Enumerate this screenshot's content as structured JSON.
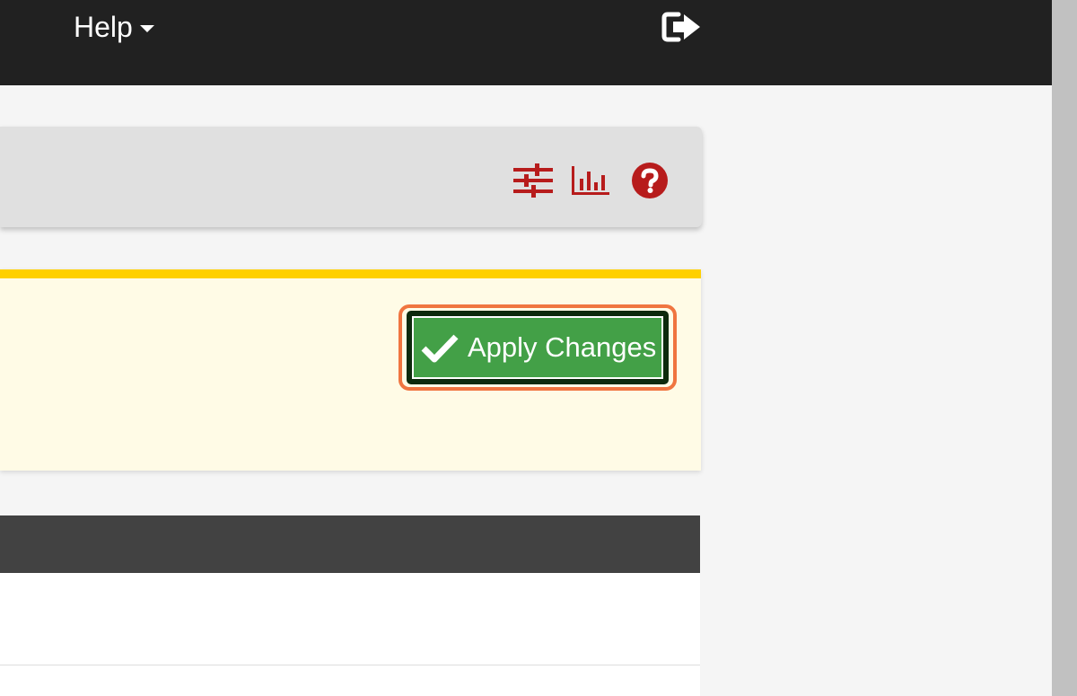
{
  "topnav": {
    "help_label": "Help",
    "logout_icon": "sign-out-icon"
  },
  "panel_header": {
    "icons": [
      "sliders-icon",
      "bar-chart-icon",
      "question-circle-icon"
    ],
    "icon_color": "#b71c1c"
  },
  "alert": {
    "apply_button_label": "Apply Changes",
    "apply_button_icon": "check-icon",
    "accent_color": "#ffd000"
  },
  "colors": {
    "navbar": "#212121",
    "apply_button": "#43a047",
    "highlight": "#f07540"
  }
}
